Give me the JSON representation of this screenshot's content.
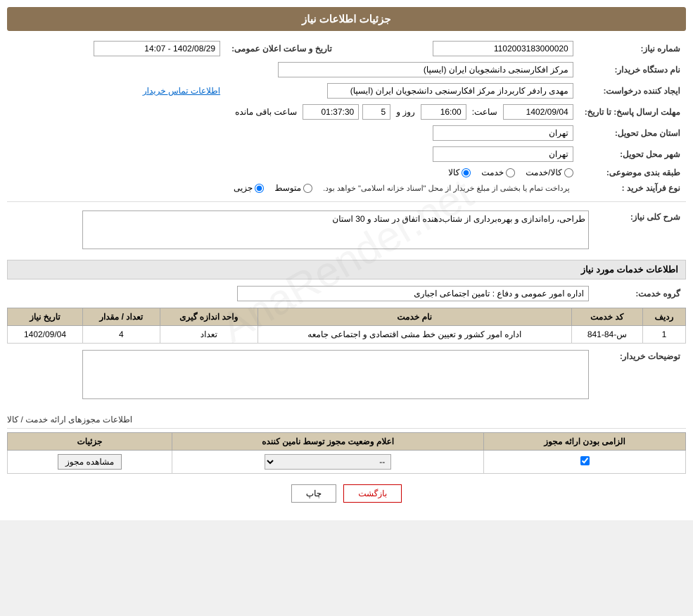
{
  "page": {
    "header": "جزئیات اطلاعات نیاز",
    "fields": {
      "need_number_label": "شماره نیاز:",
      "need_number_value": "1102003183000020",
      "buyer_org_label": "نام دستگاه خریدار:",
      "buyer_org_value": "مرکز افکارسنجی دانشجویان ایران (ایسپا)",
      "requester_label": "ایجاد کننده درخواست:",
      "requester_value": "مهدی رادفر کاربرداز مرکز افکارسنجی دانشجویان ایران (ایسپا)",
      "contact_link": "اطلاعات تماس خریدار",
      "deadline_label": "مهلت ارسال پاسخ: تا تاریخ:",
      "deadline_date": "1402/09/04",
      "deadline_time_label": "ساعت:",
      "deadline_time": "16:00",
      "deadline_days_label": "روز و",
      "deadline_days": "5",
      "deadline_remaining_label": "ساعت باقی مانده",
      "deadline_remaining": "01:37:30",
      "delivery_province_label": "استان محل تحویل:",
      "delivery_province_value": "تهران",
      "delivery_city_label": "شهر محل تحویل:",
      "delivery_city_value": "تهران",
      "subject_label": "طبقه بندی موضوعی:",
      "subject_kala": "کالا",
      "subject_khedmat": "خدمت",
      "subject_kala_khedmat": "کالا/خدمت",
      "process_label": "نوع فرآیند خرید :",
      "process_jozii": "جزیی",
      "process_mottaset": "متوسط",
      "process_note": "پرداخت تمام یا بخشی از مبلغ خریدار از محل \"اسناد خزانه اسلامی\" خواهد بود.",
      "announcement_label": "تاریخ و ساعت اعلان عمومی:",
      "announcement_value": "1402/08/29 - 14:07"
    },
    "need_description": {
      "section_title": "شرح کلی نیاز:",
      "content": "طراحی، راه‌اندازی و بهره‌برداری از شتاب‌دهنده اتفاق در ستاد و 30 استان"
    },
    "services_section": {
      "title": "اطلاعات خدمات مورد نیاز",
      "service_group_label": "گروه خدمت:",
      "service_group_value": "اداره امور عمومی و دفاع : تامین اجتماعی اجباری",
      "table_headers": [
        "ردیف",
        "کد خدمت",
        "نام خدمت",
        "واحد اندازه گیری",
        "تعداد / مقدار",
        "تاریخ نیاز"
      ],
      "table_rows": [
        {
          "row": "1",
          "code": "س-84-841",
          "name": "اداره امور کشور و تعیین خط مشی اقتصادی و اجتماعی جامعه",
          "unit": "تعداد",
          "quantity": "4",
          "date": "1402/09/04"
        }
      ]
    },
    "buyer_notes": {
      "label": "توضیحات خریدار:",
      "content": ""
    },
    "licenses_section": {
      "title": "اطلاعات مجوزهای ارائه خدمت / کالا",
      "table_headers": [
        "الزامی بودن ارائه مجوز",
        "اعلام وضعیت مجوز توسط نامین کننده",
        "جزئیات"
      ],
      "table_rows": [
        {
          "mandatory": true,
          "status": "--",
          "view_button": "مشاهده مجوز"
        }
      ]
    },
    "buttons": {
      "print": "چاپ",
      "back": "بازگشت"
    }
  }
}
